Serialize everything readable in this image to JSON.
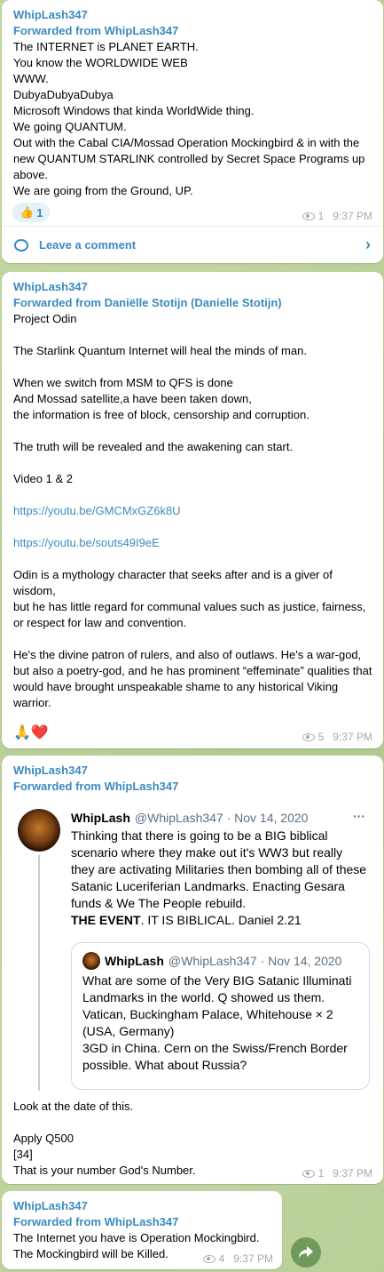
{
  "messages": [
    {
      "author": "WhipLash347",
      "forwarded": "Forwarded from WhipLash347",
      "text": "The INTERNET is PLANET EARTH.\nYou know the WORLDWIDE WEB\nWWW.\nDubyaDubyaDubya\nMicrosoft Windows that kinda WorldWide thing.\nWe going QUANTUM.\nOut with the Cabal CIA/Mossad Operation Mockingbird & in with the new QUANTUM STARLINK controlled by Secret Space Programs up above.\nWe are going from the Ground, UP.",
      "reaction_emoji": "👍",
      "reaction_count": "1",
      "views": "1",
      "time": "9:37 PM",
      "comment_label": "Leave a comment"
    },
    {
      "author": "WhipLash347",
      "forwarded": "Forwarded from Daniëlle Stotijn (Danielle Stotijn)",
      "lines_a": "Project Odin\n\nThe Starlink Quantum Internet will heal the minds of man.\n\nWhen we switch from MSM to QFS is done\nAnd Mossad satellite,a have been taken down,\nthe information is free of block, censorship and corruption.\n\nThe truth will be revealed and the awakening can start.\n\nVideo 1 & 2",
      "link1": "https://youtu.be/GMCMxGZ6k8U",
      "link2": "https://youtu.be/souts49I9eE",
      "lines_b": "Odin is a mythology character that seeks after and is a giver of wisdom,\nbut he has little regard for communal values such as justice, fairness, or respect for law and convention.\n\nHe's the divine patron of rulers, and also of outlaws. He's a war-god, but also a poetry-god, and he has prominent “effeminate” qualities that would have brought unspeakable shame to any historical Viking warrior.",
      "reactions": "🙏❤️",
      "views": "5",
      "time": "9:37 PM"
    },
    {
      "author": "WhipLash347",
      "forwarded": "Forwarded from WhipLash347",
      "tweet": {
        "name": "WhipLash",
        "handle": "@WhipLash347 · Nov 14, 2020",
        "more": "···",
        "text": "Thinking that there is going to be a BIG biblical scenario where they make out it's WW3 but really they are activating Militaries then bombing all of these Satanic Luceriferian Landmarks. Enacting Gesara funds & We The People rebuild.",
        "bold": "THE EVENT",
        "tail": ". IT IS BIBLICAL. Daniel 2.21",
        "quote_name": "WhipLash",
        "quote_handle": "@WhipLash347 · Nov 14, 2020",
        "quote_text": "What are some of the Very BIG Satanic Illuminati Landmarks in the world. Q showed us them.  Vatican, Buckingham Palace, Whitehouse × 2 (USA, Germany)\n3GD in China. Cern on the Swiss/French Border possible. What about Russia?"
      },
      "text": "Look at the date of this.\n\nApply Q500\n[34]\nThat is your number God's Number.",
      "views": "1",
      "time": "9:37 PM"
    },
    {
      "author": "WhipLash347",
      "forwarded": "Forwarded from WhipLash347",
      "text": "The Internet you have is Operation Mockingbird.\nThe Mockingbird will be Killed.",
      "views": "4",
      "time": "9:37 PM"
    }
  ],
  "share_icon": "share-arrow-icon"
}
